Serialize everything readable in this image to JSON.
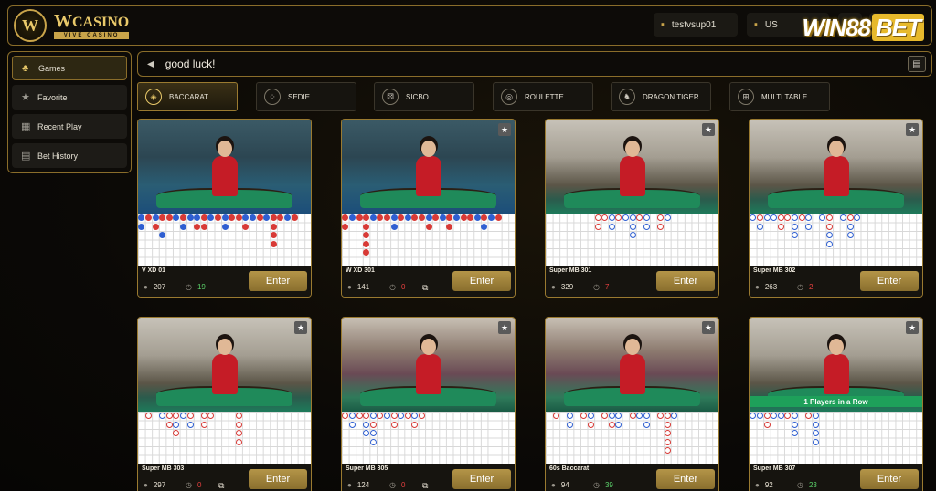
{
  "header": {
    "logo_letter": "W",
    "logo_main_w": "W",
    "logo_main_rest": "CASINO",
    "logo_sub": "VIVE CASINO",
    "username": "testvsup01",
    "currency": "US",
    "watermark_win": "WIN88",
    "watermark_bet": "BET"
  },
  "sidebar": {
    "items": [
      {
        "label": "Games",
        "icon": "♣"
      },
      {
        "label": "Favorite",
        "icon": "★"
      },
      {
        "label": "Recent Play",
        "icon": "▦"
      },
      {
        "label": "Bet History",
        "icon": "▤"
      }
    ]
  },
  "announcement": {
    "text": "good luck!",
    "icon": "◀"
  },
  "tabs": [
    {
      "label": "BACCARAT",
      "icon": "◈"
    },
    {
      "label": "SEDIE",
      "icon": "⁘"
    },
    {
      "label": "SICBO",
      "icon": "⚄"
    },
    {
      "label": "ROULETTE",
      "icon": "◎"
    },
    {
      "label": "DRAGON TIGER",
      "icon": "♞"
    },
    {
      "label": "MULTI TABLE",
      "icon": "⊞"
    }
  ],
  "tables": [
    {
      "name": "V XD 01",
      "players": "207",
      "timer": "19",
      "timer_color": "green",
      "multi": false,
      "enter": "Enter",
      "banner": ""
    },
    {
      "name": "W XD 301",
      "players": "141",
      "timer": "0",
      "timer_color": "red",
      "multi": true,
      "enter": "Enter",
      "banner": ""
    },
    {
      "name": "Super MB 301",
      "players": "329",
      "timer": "7",
      "timer_color": "red",
      "multi": false,
      "enter": "Enter",
      "banner": ""
    },
    {
      "name": "Super MB 302",
      "players": "263",
      "timer": "2",
      "timer_color": "red",
      "multi": false,
      "enter": "Enter",
      "banner": ""
    },
    {
      "name": "Super MB 303",
      "players": "297",
      "timer": "0",
      "timer_color": "red",
      "multi": true,
      "enter": "Enter",
      "banner": ""
    },
    {
      "name": "Super MB 305",
      "players": "124",
      "timer": "0",
      "timer_color": "red",
      "multi": true,
      "enter": "Enter",
      "banner": ""
    },
    {
      "name": "60s Baccarat",
      "players": "94",
      "timer": "39",
      "timer_color": "green",
      "multi": false,
      "enter": "Enter",
      "banner": ""
    },
    {
      "name": "Super MB 307",
      "players": "92",
      "timer": "23",
      "timer_color": "green",
      "multi": false,
      "enter": "Enter",
      "banner": "1 Players in a Row"
    }
  ]
}
